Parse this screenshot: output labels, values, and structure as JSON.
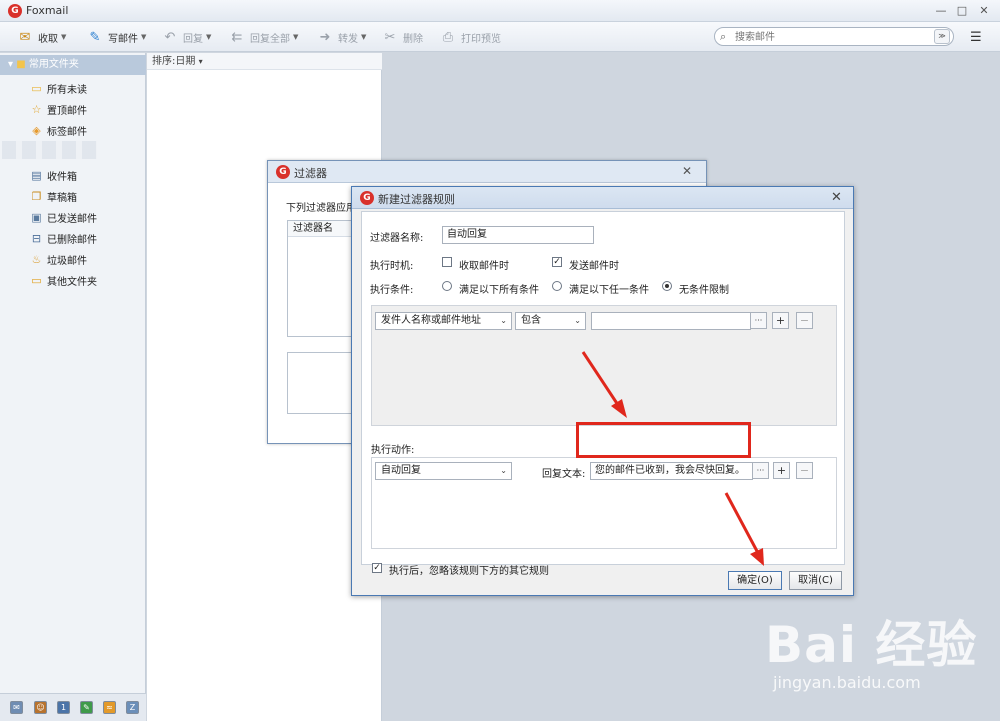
{
  "app": {
    "title": "Foxmail",
    "logo": "G"
  },
  "window_controls": {
    "minimize": "—",
    "maximize": "□",
    "close": "✕"
  },
  "toolbar": {
    "receive": "收取",
    "compose": "写邮件",
    "reply": "回复",
    "reply_all": "回复全部",
    "forward": "转发",
    "delete": "删除",
    "print_preview": "打印预览"
  },
  "search": {
    "placeholder": "搜索邮件"
  },
  "sidebar": {
    "header": "常用文件夹",
    "favorites": [
      {
        "label": "所有未读",
        "icon": "folder-icon"
      },
      {
        "label": "置顶邮件",
        "icon": "star-icon"
      },
      {
        "label": "标签邮件",
        "icon": "tag-icon"
      }
    ],
    "folders": [
      {
        "label": "收件箱",
        "icon": "inbox-icon"
      },
      {
        "label": "草稿箱",
        "icon": "drafts-icon"
      },
      {
        "label": "已发送邮件",
        "icon": "sent-icon"
      },
      {
        "label": "已删除邮件",
        "icon": "trash-icon"
      },
      {
        "label": "垃圾邮件",
        "icon": "junk-icon"
      },
      {
        "label": "其他文件夹",
        "icon": "other-folder-icon"
      }
    ]
  },
  "list": {
    "sort_label": "排序:日期"
  },
  "filter_dialog": {
    "title": "过滤器",
    "description": "下列过滤器应用",
    "column_header": "过滤器名"
  },
  "rule_dialog": {
    "title": "新建过滤器规则",
    "name_label": "过滤器名称:",
    "name_value": "自动回复",
    "timing_label": "执行时机:",
    "timing_receive": "收取邮件时",
    "timing_receive_checked": false,
    "timing_send": "发送邮件时",
    "timing_send_checked": true,
    "condition_label": "执行条件:",
    "condition_all": "满足以下所有条件",
    "condition_any": "满足以下任一条件",
    "condition_none": "无条件限制",
    "condition_selected": "无条件限制",
    "cond_field": "发件人名称或邮件地址",
    "cond_op": "包含",
    "cond_value": "",
    "action_label": "执行动作:",
    "action_type": "自动回复",
    "reply_text_label": "回复文本:",
    "reply_text_value": "您的邮件已收到，我会尽快回复。",
    "skip_rules_label": "执行后，忽略该规则下方的其它规则",
    "skip_rules_checked": true,
    "ok": "确定(O)",
    "cancel": "取消(C)",
    "ellipsis": "···",
    "plus": "+",
    "minus": "−"
  },
  "annotation": {
    "highlight_color": "#e0271c"
  },
  "watermark": {
    "brand": "Bai 经验",
    "url": "jingyan.baidu.com"
  }
}
